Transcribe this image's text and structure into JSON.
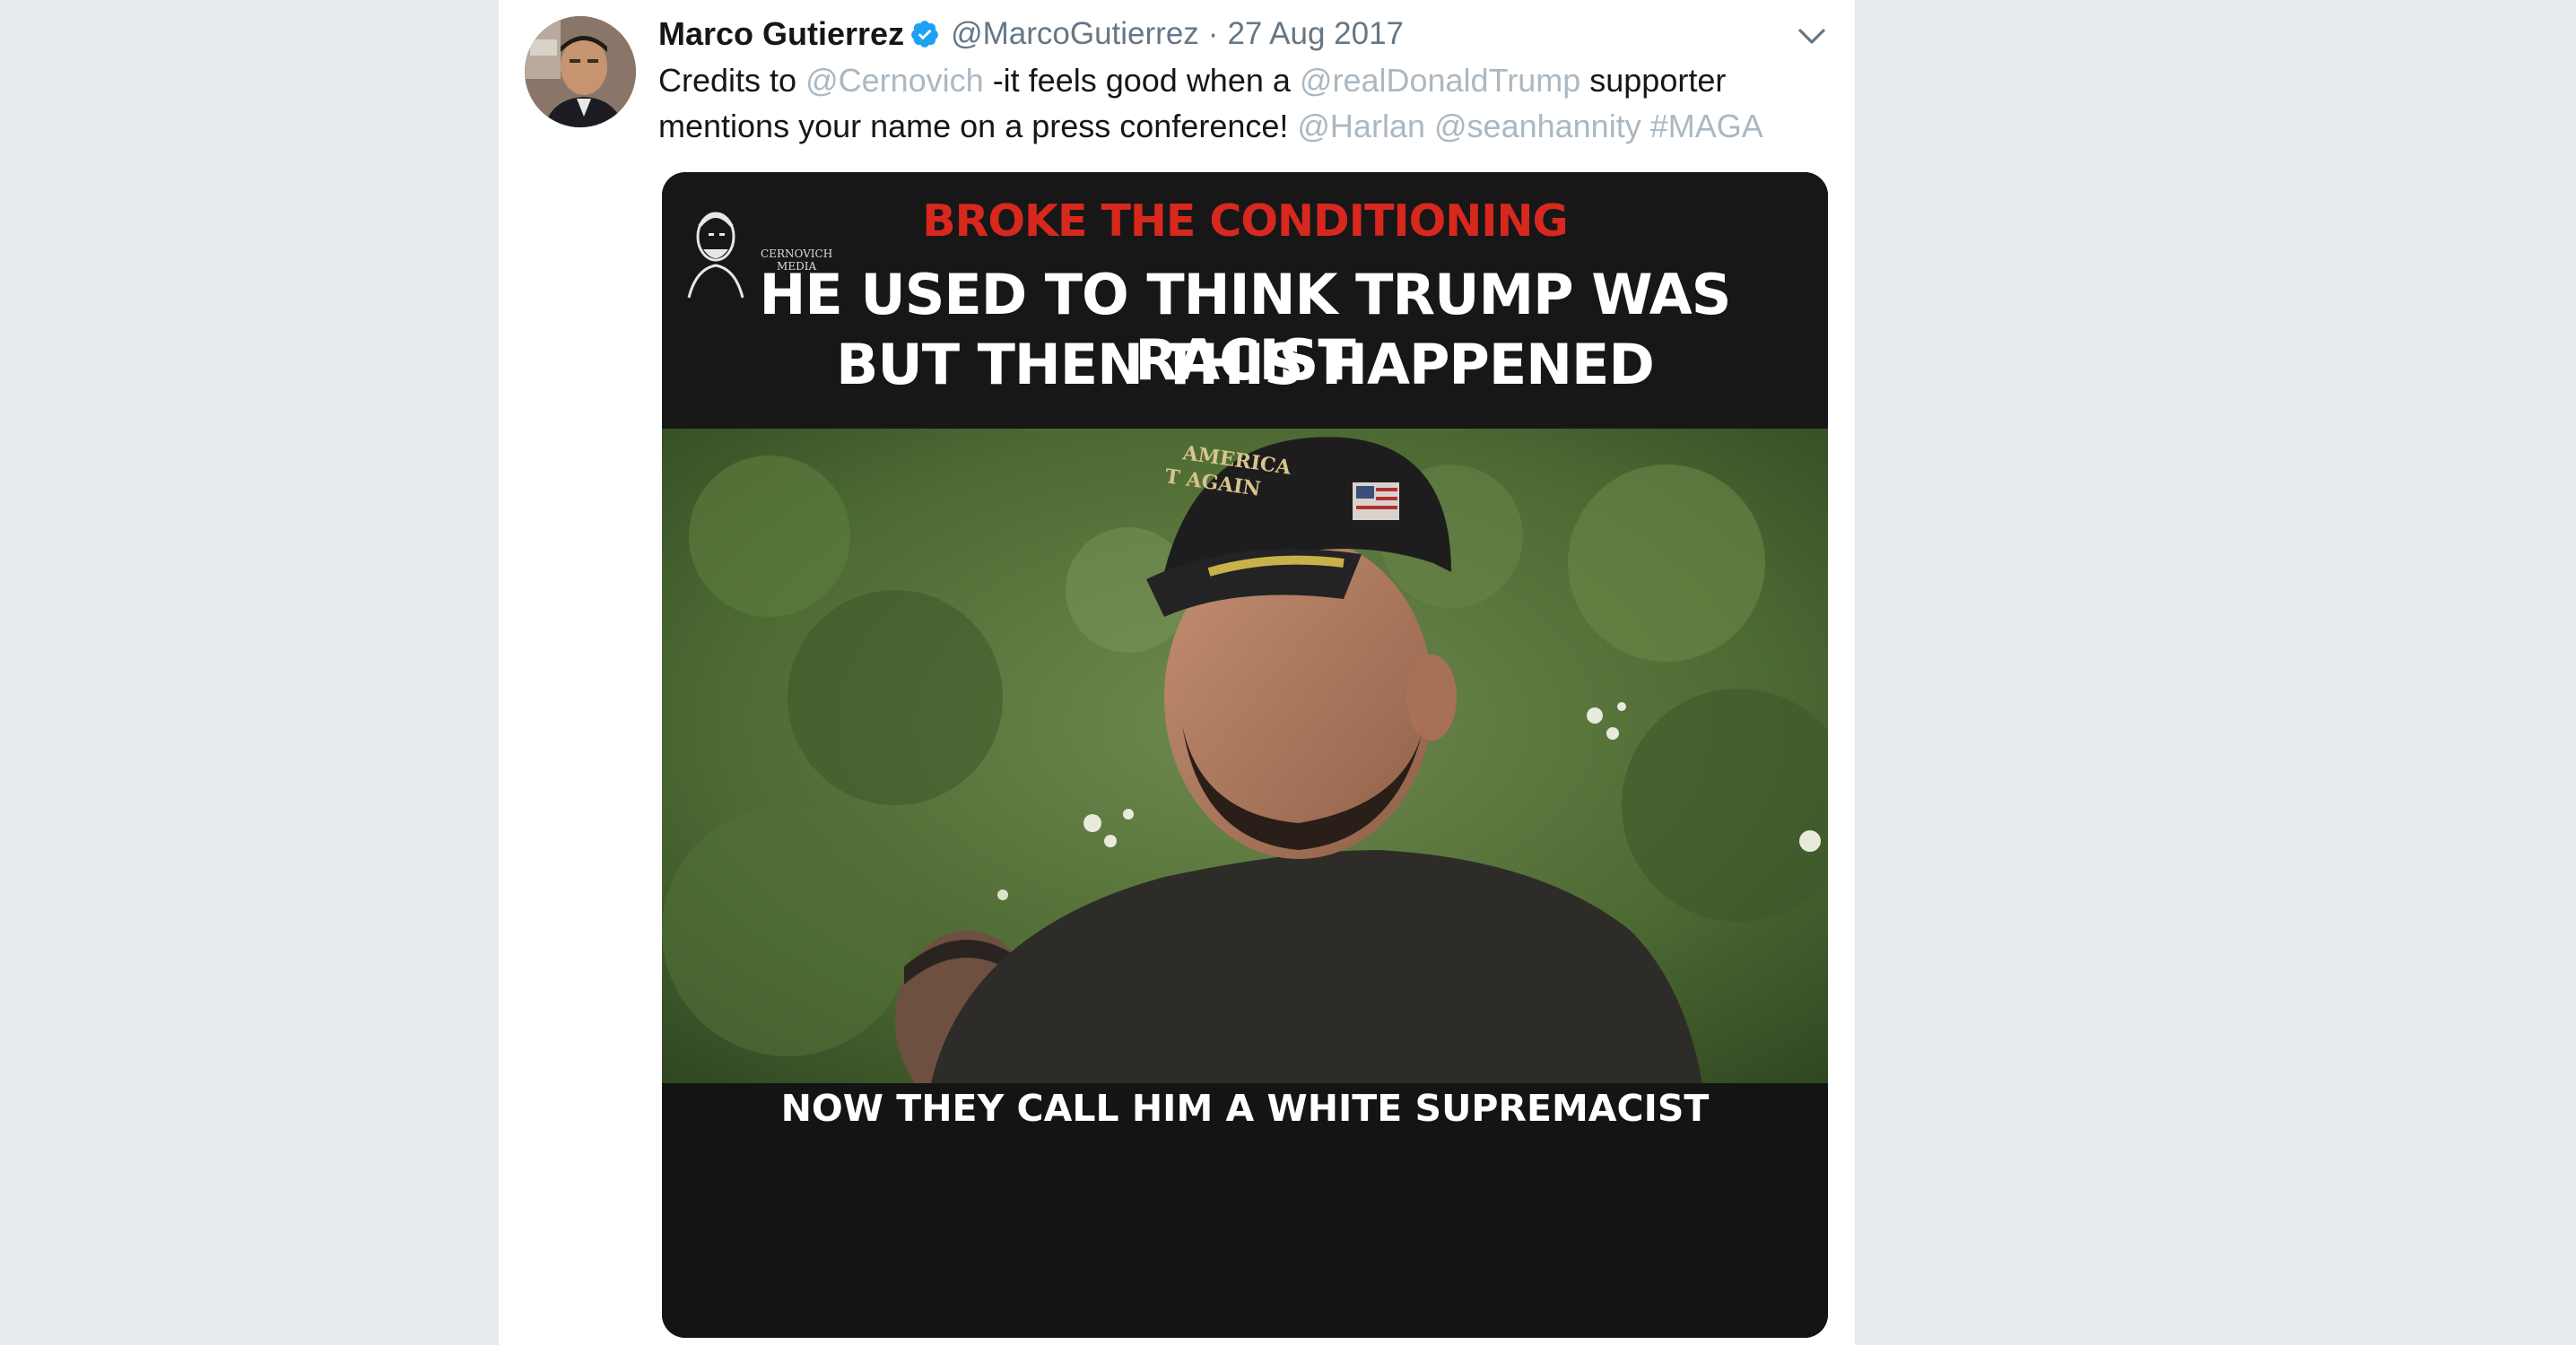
{
  "tweet": {
    "display_name": "Marco Gutierrez",
    "handle": "@MarcoGutierrez",
    "separator": "·",
    "date": "27 Aug 2017",
    "text": {
      "l1_a": "Credits to ",
      "l1_mention1": "@Cernovich",
      "l1_b": " -it feels good when a ",
      "l1_mention2": "@realDonaldTrump",
      "l1_c": " supporter",
      "l2_a": "mentions your name on a press conference! ",
      "l2_mention3": "@Harlan",
      "l2_mention4": "@seanhannity",
      "l2_hashtag": "#MAGA"
    },
    "icons": {
      "verified": "verified-badge-icon",
      "caret": "chevron-down-icon"
    }
  },
  "media": {
    "caption_red": "BROKE THE CONDITIONING",
    "caption_line1": "HE USED TO THINK TRUMP WAS RACIST",
    "caption_line2": "BUT THEN THIS HAPPENED",
    "caption_bottom": "NOW THEY CALL HIM A WHITE SUPREMACIST",
    "watermark_line1": "CERNOVICH",
    "watermark_line2": "MEDIA",
    "hat_text_line1": "AMERICA",
    "hat_text_line2": "T AGAIN"
  },
  "colors": {
    "page_bg": "#e6ecf0",
    "card_bg": "#ffffff",
    "primary_text": "#14171a",
    "secondary_text": "#657786",
    "link_text": "#abb8c2",
    "verified_blue": "#1da1f2",
    "caption_red": "#d8281e"
  }
}
